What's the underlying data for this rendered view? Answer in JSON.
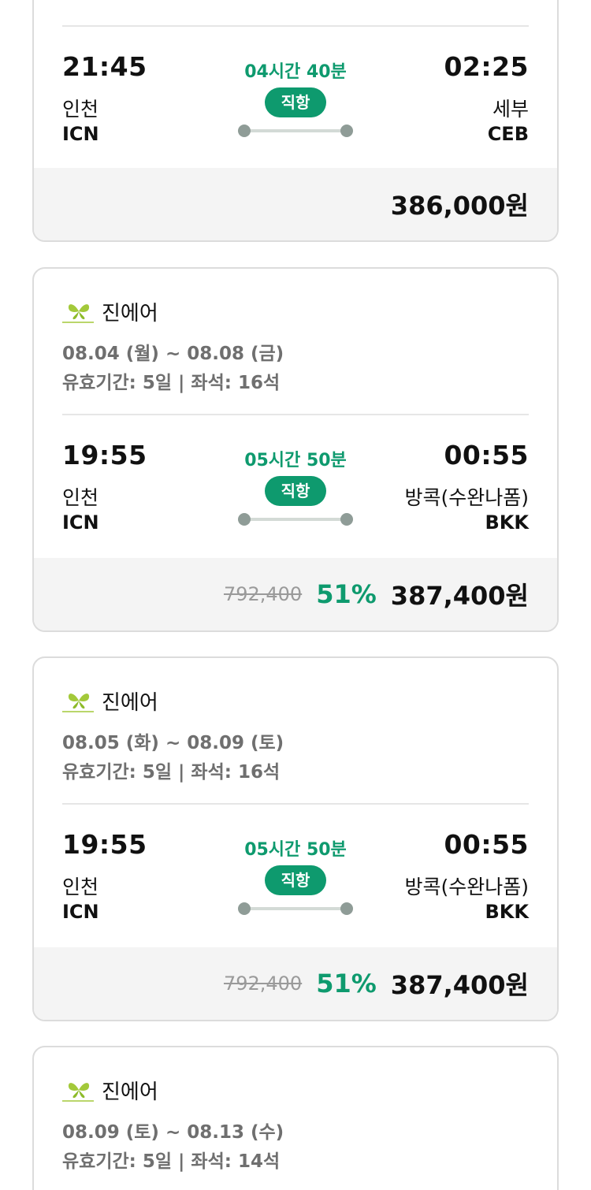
{
  "colors": {
    "accent": "#0e9a6e",
    "card_border": "#dcdcdc",
    "price_bg": "#f4f4f4",
    "muted": "#6f6f6f"
  },
  "cards": [
    {
      "flight": {
        "dep_time": "21:45",
        "dep_city": "인천",
        "dep_code": "ICN",
        "duration": "04시간 40분",
        "direct": "직항",
        "arr_time": "02:25",
        "arr_city": "세부",
        "arr_code": "CEB"
      },
      "price": {
        "final": "386,000원"
      }
    },
    {
      "airline": {
        "name": "진에어",
        "logo_icon": "jinair-logo-icon"
      },
      "dates": "08.04 (월) ~ 08.08 (금)",
      "validity": "유효기간: 5일 | 좌석: 16석",
      "flight": {
        "dep_time": "19:55",
        "dep_city": "인천",
        "dep_code": "ICN",
        "duration": "05시간 50분",
        "direct": "직항",
        "arr_time": "00:55",
        "arr_city": "방콕(수완나폼)",
        "arr_code": "BKK"
      },
      "price": {
        "original": "792,400",
        "discount": "51%",
        "final": "387,400원"
      }
    },
    {
      "airline": {
        "name": "진에어",
        "logo_icon": "jinair-logo-icon"
      },
      "dates": "08.05 (화) ~ 08.09 (토)",
      "validity": "유효기간: 5일 | 좌석: 16석",
      "flight": {
        "dep_time": "19:55",
        "dep_city": "인천",
        "dep_code": "ICN",
        "duration": "05시간 50분",
        "direct": "직항",
        "arr_time": "00:55",
        "arr_city": "방콕(수완나폼)",
        "arr_code": "BKK"
      },
      "price": {
        "original": "792,400",
        "discount": "51%",
        "final": "387,400원"
      }
    },
    {
      "airline": {
        "name": "진에어",
        "logo_icon": "jinair-logo-icon"
      },
      "dates": "08.09 (토) ~ 08.13 (수)",
      "validity": "유효기간: 5일 | 좌석: 14석"
    }
  ]
}
